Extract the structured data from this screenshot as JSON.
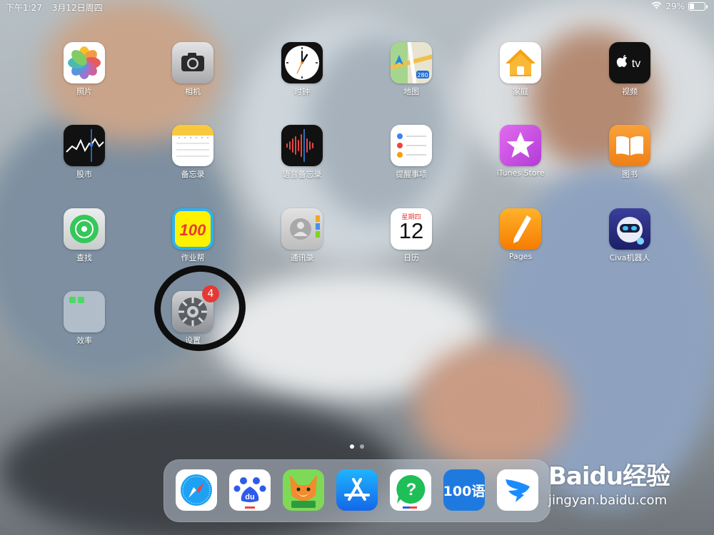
{
  "status_bar": {
    "time": "下午1:27",
    "date": "3月12日周四",
    "battery_percent": "29%",
    "battery_level": 0.29
  },
  "apps": [
    {
      "id": "photos",
      "label": "照片",
      "icon": "photos-icon"
    },
    {
      "id": "camera",
      "label": "相机",
      "icon": "camera-icon"
    },
    {
      "id": "clock",
      "label": "时钟",
      "icon": "clock-icon"
    },
    {
      "id": "maps",
      "label": "地图",
      "icon": "maps-icon",
      "glyph": "280"
    },
    {
      "id": "home",
      "label": "家庭",
      "icon": "home-icon"
    },
    {
      "id": "tv",
      "label": "视频",
      "icon": "tv-icon",
      "glyph": "tv"
    },
    {
      "id": "stocks",
      "label": "股市",
      "icon": "stocks-icon"
    },
    {
      "id": "notes",
      "label": "备忘录",
      "icon": "notes-icon"
    },
    {
      "id": "voice-memos",
      "label": "语音备忘录",
      "icon": "voice-memos-icon"
    },
    {
      "id": "reminders",
      "label": "提醒事项",
      "icon": "reminders-icon"
    },
    {
      "id": "itunes",
      "label": "iTunes Store",
      "icon": "itunes-star-icon"
    },
    {
      "id": "books",
      "label": "图书",
      "icon": "books-icon"
    },
    {
      "id": "find",
      "label": "查找",
      "icon": "find-my-icon"
    },
    {
      "id": "zuoyebang",
      "label": "作业帮",
      "icon": "zuoyebang-icon",
      "glyph": "100"
    },
    {
      "id": "contacts",
      "label": "通讯录",
      "icon": "contacts-icon"
    },
    {
      "id": "calendar",
      "label": "日历",
      "icon": "calendar-icon",
      "weekday": "星期四",
      "day": "12"
    },
    {
      "id": "pages",
      "label": "Pages",
      "icon": "pages-icon"
    },
    {
      "id": "civa",
      "label": "Civa机器人",
      "icon": "civa-robot-icon"
    },
    {
      "id": "efficiency",
      "label": "效率",
      "icon": "folder-icon"
    },
    {
      "id": "settings",
      "label": "设置",
      "icon": "settings-gear-icon",
      "badge": "4"
    }
  ],
  "dock": [
    {
      "id": "safari",
      "icon": "safari-compass-icon"
    },
    {
      "id": "baidu",
      "icon": "baidu-paw-icon",
      "glyph": "du"
    },
    {
      "id": "fox-app",
      "icon": "fox-reading-icon"
    },
    {
      "id": "app-store",
      "icon": "app-store-icon"
    },
    {
      "id": "qa-app",
      "icon": "question-mark-icon",
      "glyph": "?"
    },
    {
      "id": "yuwen",
      "icon": "yuwen-100-icon",
      "glyph": "100语"
    },
    {
      "id": "dingtalk",
      "icon": "dingtalk-icon"
    }
  ],
  "page_indicator": {
    "count": 2,
    "current": 0
  },
  "watermark": {
    "logo": "Baidu经验",
    "url": "jingyan.baidu.com"
  },
  "colors": {
    "badge": "#e53935",
    "accent_blue": "#1e88e5"
  }
}
